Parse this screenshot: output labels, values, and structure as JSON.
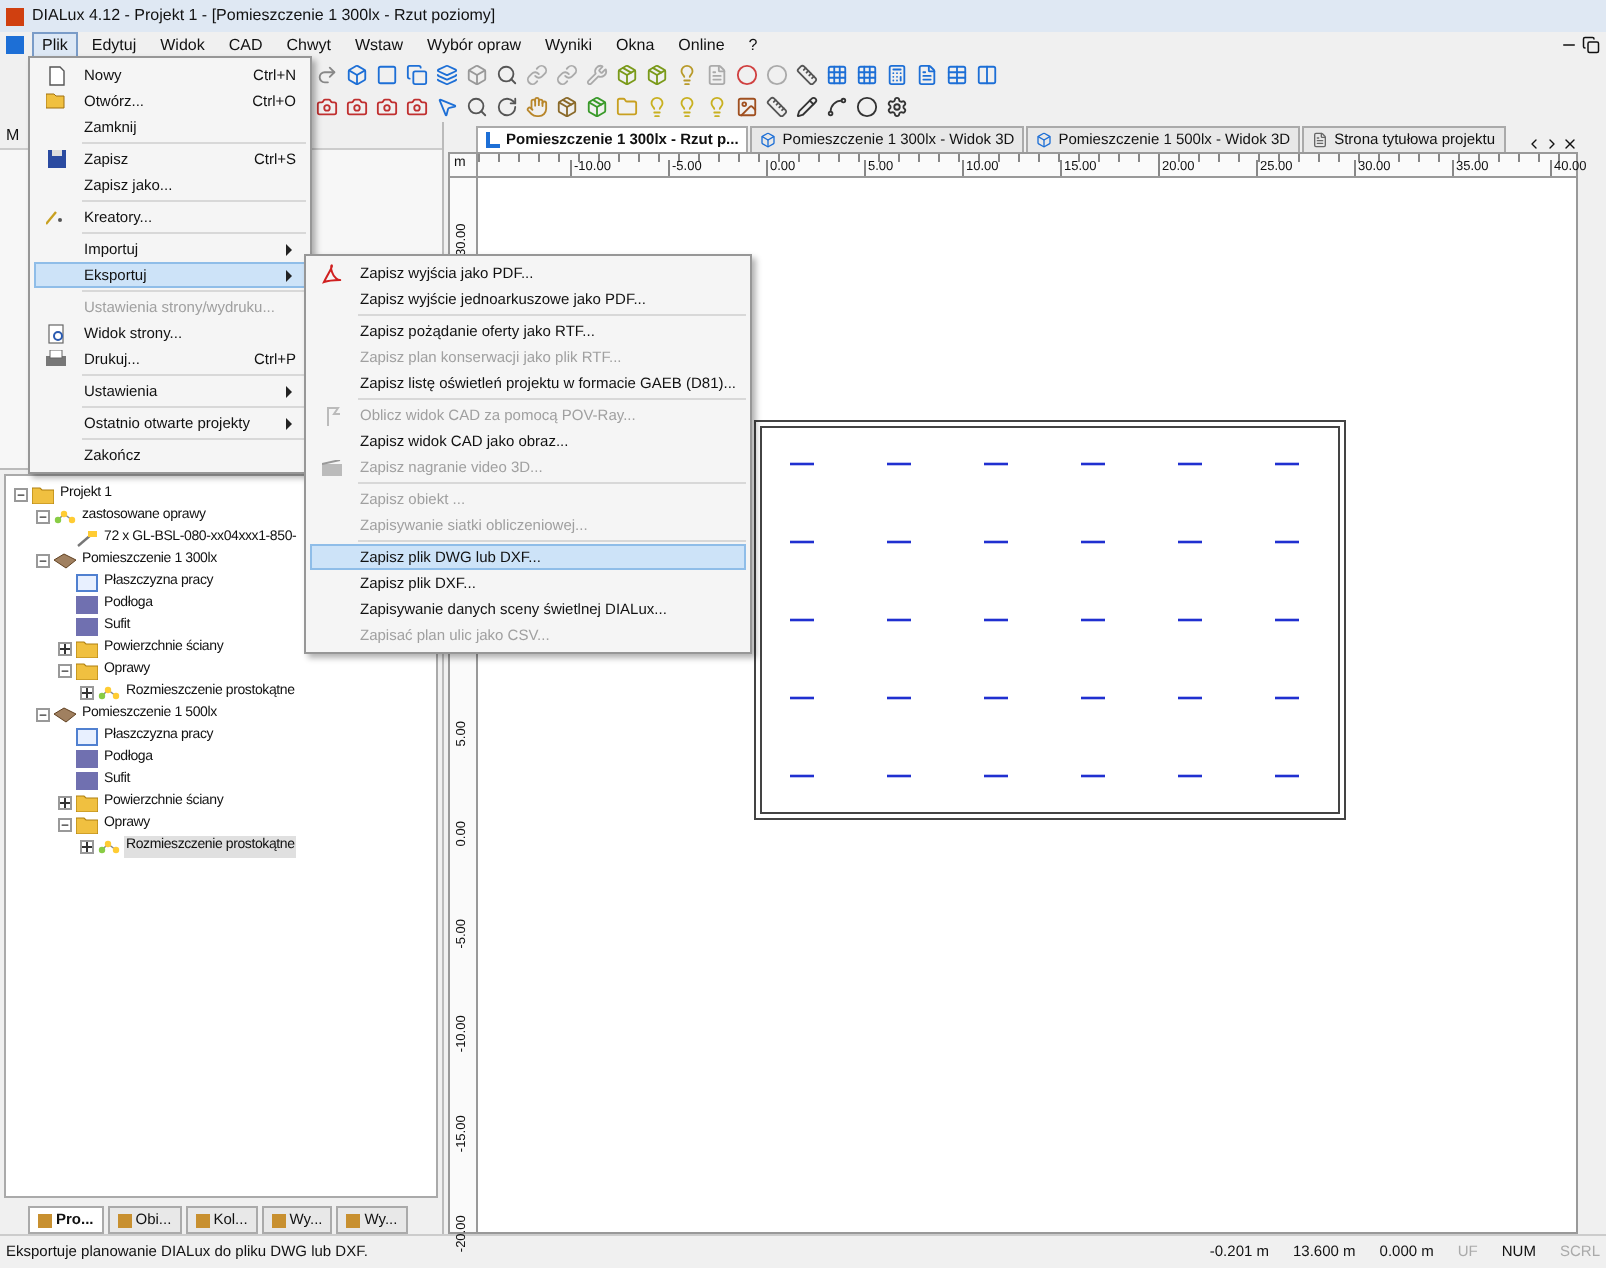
{
  "window": {
    "title": "DIALux 4.12 - Projekt 1 - [Pomieszczenie 1 300lx - Rzut poziomy]"
  },
  "menubar": [
    {
      "label": "Plik",
      "selected": true
    },
    {
      "label": "Edytuj",
      "selected": false
    },
    {
      "label": "Widok",
      "selected": false
    },
    {
      "label": "CAD",
      "selected": false
    },
    {
      "label": "Chwyt",
      "selected": false
    },
    {
      "label": "Wstaw",
      "selected": false
    },
    {
      "label": "Wybór opraw",
      "selected": false
    },
    {
      "label": "Wyniki",
      "selected": false
    },
    {
      "label": "Okna",
      "selected": false
    },
    {
      "label": "Online",
      "selected": false
    },
    {
      "label": "?",
      "selected": false
    }
  ],
  "file_menu": {
    "groups": [
      [
        {
          "label": "Nowy",
          "shortcut": "Ctrl+N",
          "disabled": false,
          "submenu": false,
          "selected": false
        },
        {
          "label": "Otwórz...",
          "shortcut": "Ctrl+O",
          "disabled": false,
          "submenu": false,
          "selected": false
        },
        {
          "label": "Zamknij",
          "disabled": false,
          "submenu": false,
          "selected": false
        }
      ],
      [
        {
          "label": "Zapisz",
          "shortcut": "Ctrl+S",
          "disabled": false,
          "submenu": false,
          "selected": false
        },
        {
          "label": "Zapisz jako...",
          "disabled": false,
          "submenu": false,
          "selected": false
        }
      ],
      [
        {
          "label": "Kreatory...",
          "disabled": false,
          "submenu": false,
          "selected": false
        }
      ],
      [
        {
          "label": "Importuj",
          "disabled": false,
          "submenu": true,
          "selected": false
        },
        {
          "label": "Eksportuj",
          "disabled": false,
          "submenu": true,
          "selected": true
        }
      ],
      [
        {
          "label": "Ustawienia strony/wydruku...",
          "disabled": true,
          "submenu": false,
          "selected": false
        },
        {
          "label": "Widok strony...",
          "disabled": false,
          "submenu": false,
          "selected": false
        },
        {
          "label": "Drukuj...",
          "shortcut": "Ctrl+P",
          "disabled": false,
          "submenu": false,
          "selected": false
        }
      ],
      [
        {
          "label": "Ustawienia",
          "disabled": false,
          "submenu": true,
          "selected": false
        }
      ],
      [
        {
          "label": "Ostatnio otwarte projekty",
          "disabled": false,
          "submenu": true,
          "selected": false
        }
      ],
      [
        {
          "label": "Zakończ",
          "disabled": false,
          "submenu": false,
          "selected": false
        }
      ]
    ]
  },
  "export_submenu": {
    "groups": [
      [
        {
          "label": "Zapisz wyjścia jako PDF...",
          "disabled": false,
          "selected": false
        },
        {
          "label": "Zapisz wyjście jednoarkuszowe jako PDF...",
          "disabled": false,
          "selected": false
        }
      ],
      [
        {
          "label": "Zapisz pożądanie oferty jako RTF...",
          "disabled": false,
          "selected": false
        },
        {
          "label": "Zapisz plan konserwacji jako plik RTF...",
          "disabled": true,
          "selected": false
        },
        {
          "label": "Zapisz listę oświetleń projektu w formacie GAEB (D81)...",
          "disabled": false,
          "selected": false
        }
      ],
      [
        {
          "label": "Oblicz widok CAD za pomocą POV-Ray...",
          "disabled": true,
          "selected": false
        },
        {
          "label": "Zapisz widok CAD jako obraz...",
          "disabled": false,
          "selected": false
        },
        {
          "label": "Zapisz nagranie video 3D...",
          "disabled": true,
          "selected": false
        }
      ],
      [
        {
          "label": "Zapisz obiekt ...",
          "disabled": true,
          "selected": false
        },
        {
          "label": "Zapisywanie siatki obliczeniowej...",
          "disabled": true,
          "selected": false
        }
      ],
      [
        {
          "label": "Zapisz plik DWG lub DXF...",
          "disabled": false,
          "selected": true
        },
        {
          "label": "Zapisz plik DXF...",
          "disabled": false,
          "selected": false
        },
        {
          "label": "Zapisywanie danych sceny świetlnej DIALux...",
          "disabled": false,
          "selected": false
        },
        {
          "label": "Zapisać plan ulic jako CSV...",
          "disabled": true,
          "selected": false
        }
      ]
    ]
  },
  "left_panel": {
    "title": "M"
  },
  "tree": [
    {
      "label": "Projekt 1",
      "kind": "folder",
      "expanded": true,
      "selected": false,
      "children": [
        {
          "label": "zastosowane oprawy",
          "kind": "group",
          "expanded": true,
          "selected": false,
          "children": [
            {
              "label": "72 x GL-BSL-080-xx04xxx1-850-",
              "kind": "luminaire",
              "selected": false
            }
          ]
        },
        {
          "label": "Pomieszczenie 1 300lx",
          "kind": "room",
          "expanded": true,
          "selected": false,
          "children": [
            {
              "label": "Płaszczyzna pracy",
              "kind": "workplane",
              "selected": false
            },
            {
              "label": "Podłoga",
              "kind": "surface",
              "selected": false
            },
            {
              "label": "Sufit",
              "kind": "surface",
              "selected": false
            },
            {
              "label": "Powierzchnie ściany",
              "kind": "folder",
              "expanded": false,
              "selected": false
            },
            {
              "label": "Oprawy",
              "kind": "folder",
              "expanded": true,
              "selected": false,
              "children": [
                {
                  "label": "Rozmieszczenie prostokątne",
                  "kind": "group",
                  "expanded": false,
                  "selected": false
                }
              ]
            }
          ]
        },
        {
          "label": "Pomieszczenie 1 500lx",
          "kind": "room",
          "expanded": true,
          "selected": false,
          "children": [
            {
              "label": "Płaszczyzna pracy",
              "kind": "workplane",
              "selected": false
            },
            {
              "label": "Podłoga",
              "kind": "surface",
              "selected": false
            },
            {
              "label": "Sufit",
              "kind": "surface",
              "selected": false
            },
            {
              "label": "Powierzchnie ściany",
              "kind": "folder",
              "expanded": false,
              "selected": false
            },
            {
              "label": "Oprawy",
              "kind": "folder",
              "expanded": true,
              "selected": false,
              "children": [
                {
                  "label": "Rozmieszczenie prostokątne",
                  "kind": "group",
                  "expanded": false,
                  "selected": true
                }
              ]
            }
          ]
        }
      ]
    }
  ],
  "panel_tabs": [
    {
      "label": "Pro...",
      "selected": true
    },
    {
      "label": "Obi...",
      "selected": false
    },
    {
      "label": "Kol...",
      "selected": false
    },
    {
      "label": "Wy...",
      "selected": false
    },
    {
      "label": "Wy...",
      "selected": false
    }
  ],
  "doc_tabs": [
    {
      "label": "Pomieszczenie 1 300lx - Rzut p...",
      "kind": "plan",
      "selected": true
    },
    {
      "label": "Pomieszczenie 1 300lx - Widok 3D",
      "kind": "view",
      "selected": false
    },
    {
      "label": "Pomieszczenie 1 500lx - Widok 3D",
      "kind": "view",
      "selected": false
    },
    {
      "label": "Strona tytułowa projektu",
      "kind": "print",
      "selected": false
    }
  ],
  "ruler": {
    "unit": "m",
    "top_labels": [
      "-10.00",
      "-5.00",
      "0.00",
      "5.00",
      "10.00",
      "15.00",
      "20.00",
      "25.00",
      "30.00",
      "35.00",
      "40.00"
    ],
    "left_labels": [
      "30.00",
      "5.00",
      "0.00",
      "-5.00",
      "-10.00",
      "-15.00",
      "-20.00"
    ]
  },
  "status_bar": {
    "message": "Eksportuje planowanie DIALux do pliku DWG lub DXF.",
    "readings": [
      "-0.201 m",
      "13.600 m",
      "0.000 m"
    ],
    "indicators": [
      {
        "label": "UF",
        "on": false
      },
      {
        "label": "NUM",
        "on": true
      },
      {
        "label": "SCRL",
        "on": false
      }
    ]
  }
}
